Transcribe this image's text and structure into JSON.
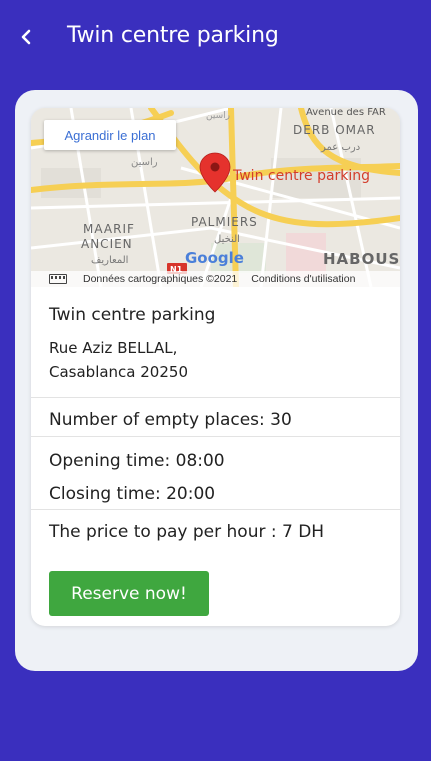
{
  "header": {
    "title": "Twin centre parking"
  },
  "map": {
    "enlarge_label": "Agrandir le plan",
    "marker_label": "Twin centre parking",
    "labels": {
      "avenue": "Avenue des FAR",
      "derb_omar": "DERB OMAR",
      "derb_omar_ar": "درب عمر",
      "palmiers": "PALMIERS",
      "palmiers_ar": "النخيل",
      "maarif": "MAARIF",
      "ancien": "ANCIEN",
      "maarif_ar": "المعاريف",
      "habous": "HABOUS",
      "rasin": "راسين",
      "road_badge": "N1",
      "google": "Google"
    },
    "footer_credits": "Données cartographiques ©2021",
    "footer_terms": "Conditions d'utilisation"
  },
  "parking": {
    "name": "Twin centre parking",
    "address_line1": "Rue Aziz BELLAL,",
    "address_line2": "Casablanca 20250",
    "empty_places": "Number of empty places: 30",
    "opening_time": "Opening time: 08:00",
    "closing_time": "Closing time: 20:00",
    "price": "The price to pay per hour : 7 DH"
  },
  "actions": {
    "reserve_label": "Reserve now!"
  },
  "colors": {
    "background": "#3a2fbe",
    "button": "#3fa73f",
    "marker": "#e5322d"
  }
}
